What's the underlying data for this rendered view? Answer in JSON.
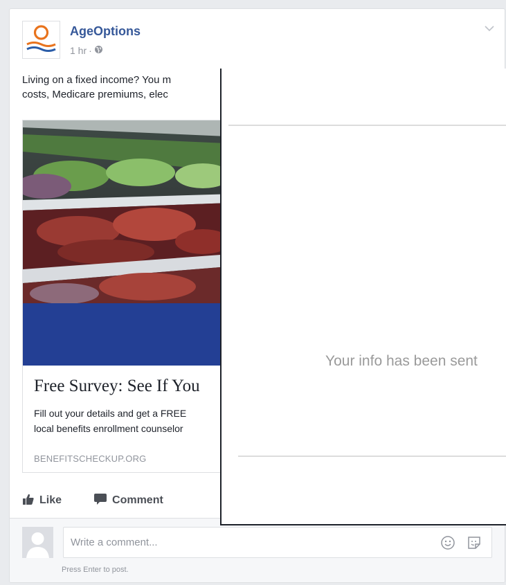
{
  "post": {
    "page_name": "AgeOptions",
    "time": "1 hr",
    "separator": "·",
    "text_line1": "Living on a fixed income? You m",
    "text_line2": "costs, Medicare premiums, elec",
    "logo_colors": {
      "orange": "#e8731d",
      "blue": "#2b5da8"
    }
  },
  "link": {
    "title": "Free Survey: See If You",
    "description_line1": "Fill out your details and get a FREE",
    "description_line2": "local benefits enrollment counselor",
    "domain": "BENEFITSCHECKUP.ORG",
    "band_color": "#233f94"
  },
  "actions": {
    "like_label": "Like",
    "comment_label": "Comment"
  },
  "comment_box": {
    "placeholder": "Write a comment...",
    "hint": "Press Enter to post."
  },
  "overlay": {
    "message": "Your info has been sent"
  },
  "icons": [
    "globe-icon",
    "chevron-down-icon",
    "like-icon",
    "comment-icon",
    "emoji-icon",
    "sticker-icon"
  ]
}
